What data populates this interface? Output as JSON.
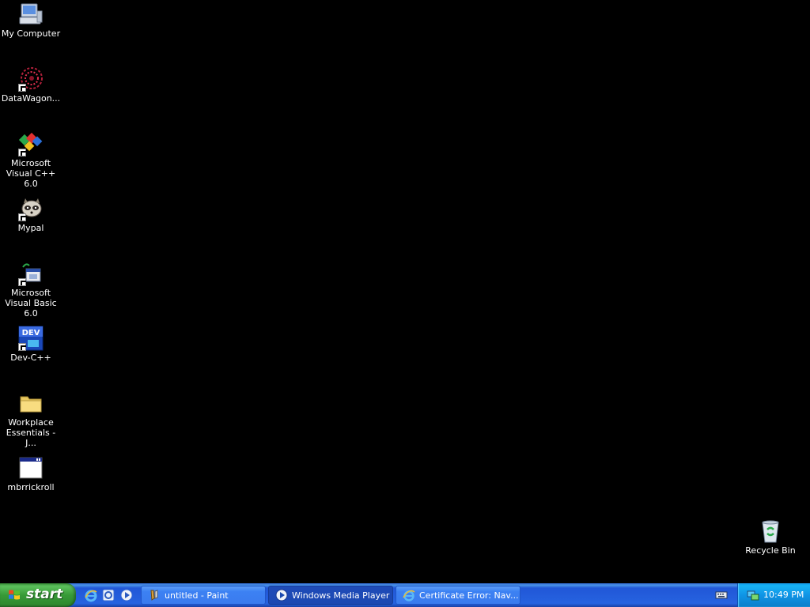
{
  "desktop": {
    "icons": [
      {
        "label": "My Computer"
      },
      {
        "label": "DataWagon..."
      },
      {
        "label": "Microsoft Visual C++ 6.0"
      },
      {
        "label": "Mypal"
      },
      {
        "label": "Microsoft Visual Basic 6.0"
      },
      {
        "label": "Dev-C++"
      },
      {
        "label": "Workplace Essentials - J..."
      },
      {
        "label": "mbrrickroll"
      },
      {
        "label": "Recycle Bin"
      }
    ]
  },
  "taskbar": {
    "start_label": "start",
    "quick_launch": [
      "internet-explorer-icon",
      "browser-icon",
      "media-player-icon"
    ],
    "buttons": [
      {
        "label": "untitled - Paint"
      },
      {
        "label": "Windows Media Player"
      },
      {
        "label": "Certificate Error: Nav..."
      }
    ],
    "tray_icons": [
      "keyboard-icon",
      "network-icon"
    ],
    "clock": "10:49 PM"
  },
  "colors": {
    "desktop_bg": "#000000",
    "taskbar_blue": "#2663e0",
    "start_green": "#379a37",
    "tray_blue": "#0f94e6"
  }
}
